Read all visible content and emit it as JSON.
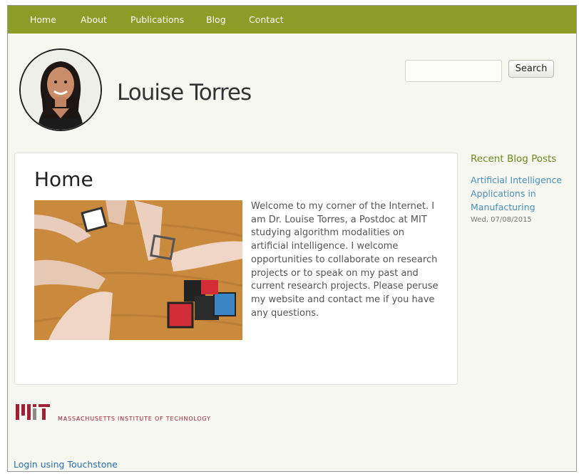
{
  "nav": {
    "items": [
      {
        "label": "Home"
      },
      {
        "label": "About"
      },
      {
        "label": "Publications"
      },
      {
        "label": "Blog"
      },
      {
        "label": "Contact"
      }
    ]
  },
  "header": {
    "site_title": "Louise Torres",
    "avatar_icon": "profile-photo",
    "search": {
      "placeholder": "",
      "button_label": "Search"
    }
  },
  "main": {
    "heading": "Home",
    "image_icon": "robot-cubes-photo",
    "intro": "Welcome to my corner of the Internet. I am Dr. Louise Torres, a Postdoc at MIT studying algorithm modalities on artificial intelligence. I welcome opportunities to collaborate on research projects or to speak on my past and current research projects. Please peruse my website and contact me if you have any questions."
  },
  "sidebar": {
    "heading": "Recent Blog Posts",
    "posts": [
      {
        "title": "Artificial Intelligence Applications in Manufacturing",
        "date": "Wed, 07/08/2015"
      }
    ]
  },
  "footer": {
    "institution": "MASSACHUSETTS INSTITUTE OF TECHNOLOGY",
    "login_link": "Login using Touchstone"
  },
  "colors": {
    "nav_background": "#8c9c26",
    "sidebar_heading": "#6f8a1f",
    "link": "#4b90b6",
    "mit_red": "#a31f34"
  }
}
